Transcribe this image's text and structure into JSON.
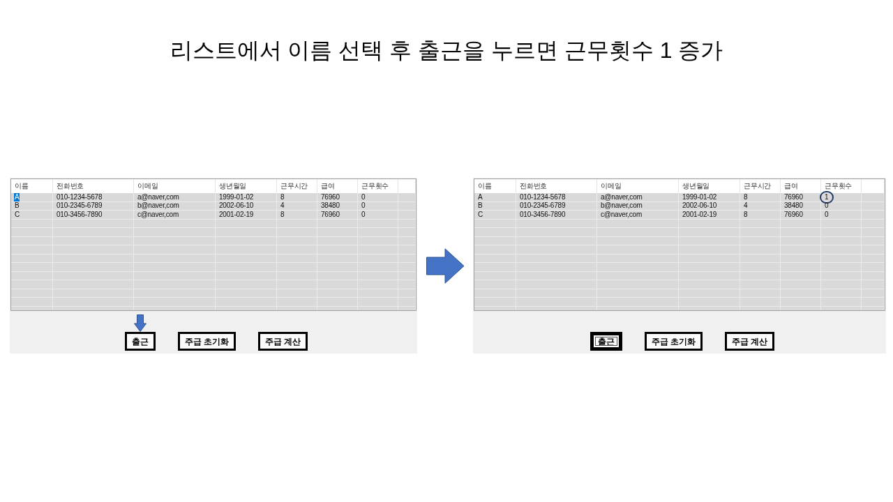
{
  "title": "리스트에서 이름 선택 후 출근을 누르면 근무횟수 1 증가",
  "screens": [
    {
      "columns": [
        "이름",
        "전화번호",
        "이메일",
        "생년월일",
        "근무시간",
        "급여",
        "근무횟수"
      ],
      "rows": [
        {
          "selected": true,
          "cells": [
            {
              "text": "A",
              "circled": false
            },
            {
              "text": "010-1234-5678",
              "circled": false
            },
            {
              "text": "a@naver,com",
              "circled": false
            },
            {
              "text": "1999-01-02",
              "circled": false
            },
            {
              "text": "8",
              "circled": false
            },
            {
              "text": "76960",
              "circled": false
            },
            {
              "text": "0",
              "circled": false
            }
          ]
        },
        {
          "selected": false,
          "cells": [
            {
              "text": "B",
              "circled": false
            },
            {
              "text": "010-2345-6789",
              "circled": false
            },
            {
              "text": "b@naver,com",
              "circled": false
            },
            {
              "text": "2002-06-10",
              "circled": false
            },
            {
              "text": "4",
              "circled": false
            },
            {
              "text": "38480",
              "circled": false
            },
            {
              "text": "0",
              "circled": false
            }
          ]
        },
        {
          "selected": false,
          "cells": [
            {
              "text": "C",
              "circled": false
            },
            {
              "text": "010-3456-7890",
              "circled": false
            },
            {
              "text": "c@naver,com",
              "circled": false
            },
            {
              "text": "2001-02-19",
              "circled": false
            },
            {
              "text": "8",
              "circled": false
            },
            {
              "text": "76960",
              "circled": false
            },
            {
              "text": "0",
              "circled": false
            }
          ]
        }
      ],
      "buttons": [
        {
          "label": "출근",
          "focused": false,
          "pointed": true
        },
        {
          "label": "주급 초기화",
          "focused": false,
          "pointed": false
        },
        {
          "label": "주급 계산",
          "focused": false,
          "pointed": false
        }
      ]
    },
    {
      "columns": [
        "이름",
        "전화번호",
        "이메일",
        "생년월일",
        "근무시간",
        "급여",
        "근무횟수"
      ],
      "rows": [
        {
          "selected": false,
          "cells": [
            {
              "text": "A",
              "circled": false
            },
            {
              "text": "010-1234-5678",
              "circled": false
            },
            {
              "text": "a@naver,com",
              "circled": false
            },
            {
              "text": "1999-01-02",
              "circled": false
            },
            {
              "text": "8",
              "circled": false
            },
            {
              "text": "76960",
              "circled": false
            },
            {
              "text": "1",
              "circled": true
            }
          ]
        },
        {
          "selected": false,
          "cells": [
            {
              "text": "B",
              "circled": false
            },
            {
              "text": "010-2345-6789",
              "circled": false
            },
            {
              "text": "b@naver,com",
              "circled": false
            },
            {
              "text": "2002-06-10",
              "circled": false
            },
            {
              "text": "4",
              "circled": false
            },
            {
              "text": "38480",
              "circled": false
            },
            {
              "text": "0",
              "circled": false
            }
          ]
        },
        {
          "selected": false,
          "cells": [
            {
              "text": "C",
              "circled": false
            },
            {
              "text": "010-3456-7890",
              "circled": false
            },
            {
              "text": "c@naver,com",
              "circled": false
            },
            {
              "text": "2001-02-19",
              "circled": false
            },
            {
              "text": "8",
              "circled": false
            },
            {
              "text": "76960",
              "circled": false
            },
            {
              "text": "0",
              "circled": false
            }
          ]
        }
      ],
      "buttons": [
        {
          "label": "출근",
          "focused": true,
          "pointed": false
        },
        {
          "label": "주급 초기화",
          "focused": false,
          "pointed": false
        },
        {
          "label": "주급 계산",
          "focused": false,
          "pointed": false
        }
      ]
    }
  ]
}
